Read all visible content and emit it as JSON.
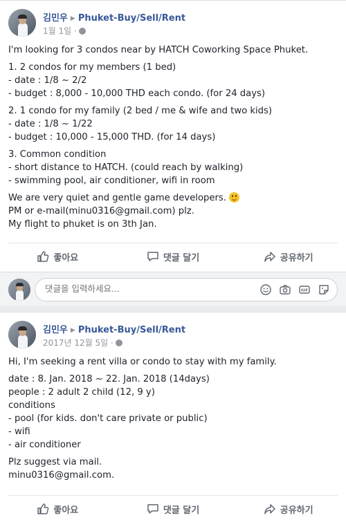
{
  "posts": [
    {
      "author": "김민우",
      "group": "Phuket-Buy/Sell/Rent",
      "date": "1월 1일 ·",
      "paragraphs": [
        "I'm looking for 3 condos near by HATCH Coworking Space Phuket.",
        "1. 2 condos for my members (1 bed)\n- date : 1/8 ~ 2/2\n- budget : 8,000 - 10,000 THD each condo. (for 24 days)",
        "2. 1 condo for my family (2 bed / me & wife and two kids)\n- date : 1/8 ~ 1/22\n- budget : 10,000 - 15,000 THD. (for 14 days)",
        "3. Common condition\n- short distance to HATCH. (could reach by walking)\n- swimming pool, air conditioner, wifi in room",
        "We are very quiet and gentle game developers.",
        "PM or e-mail(minu0316@gmail.com) plz.\nMy flight to phuket is on 3th Jan."
      ]
    },
    {
      "author": "김민우",
      "group": "Phuket-Buy/Sell/Rent",
      "date": "2017년 12월 5일 ·",
      "paragraphs": [
        "Hi, I'm seeking a rent villa or condo to stay with my family.",
        "date : 8. Jan. 2018 ~ 22. Jan. 2018 (14days)\npeople : 2 adult 2 child (12, 9 y)\nconditions\n- pool (for kids. don't care private or public)\n- wifi\n- air conditioner",
        "Plz suggest via mail.\nminu0316@gmail.com."
      ]
    }
  ],
  "actions": {
    "like": "좋아요",
    "comment": "댓글 달기",
    "share": "공유하기"
  },
  "comment_box": {
    "placeholder": "댓글을 입력하세요..."
  },
  "icons": [
    "like-icon",
    "comment-icon",
    "share-icon",
    "emoji-icon",
    "camera-icon",
    "gif-icon",
    "sticker-icon",
    "globe-icon",
    "caret-right-icon"
  ],
  "colors": {
    "link": "#385898",
    "muted": "#90949c",
    "action": "#606770"
  }
}
